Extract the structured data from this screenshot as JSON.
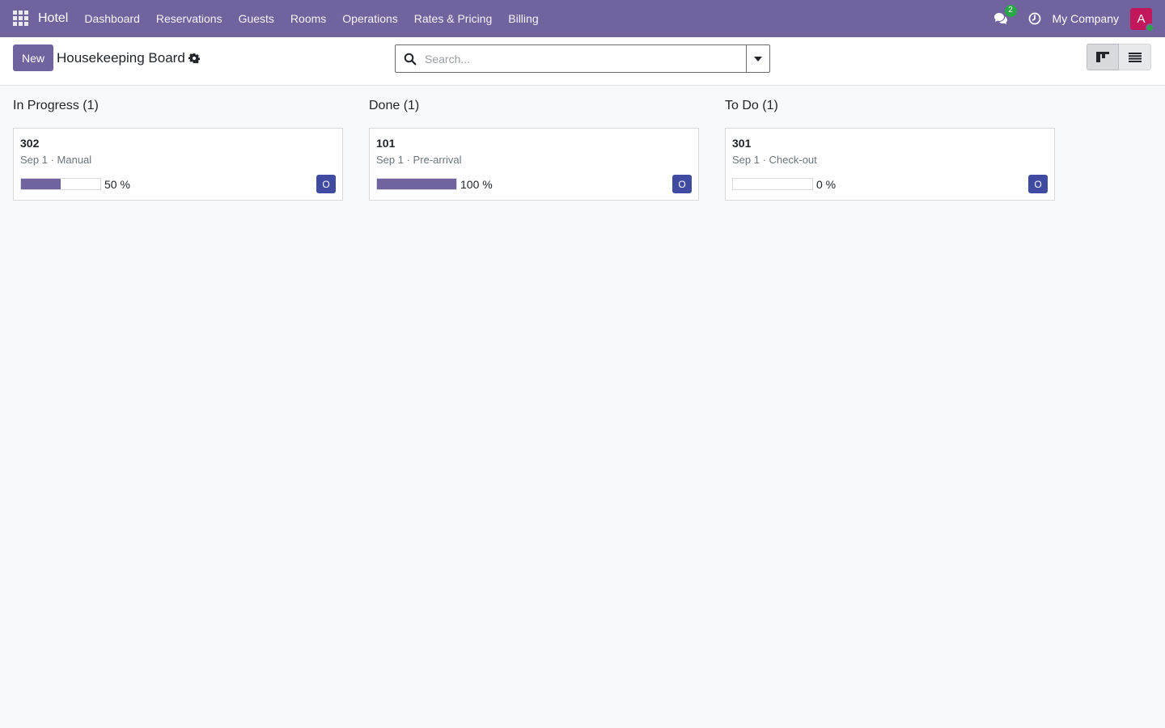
{
  "navbar": {
    "app_name": "Hotel",
    "menu": [
      "Dashboard",
      "Reservations",
      "Guests",
      "Rooms",
      "Operations",
      "Rates & Pricing",
      "Billing"
    ],
    "messages_count": "2",
    "company": "My Company",
    "user_initial": "A",
    "bar_color": "#71639e",
    "avatar_color": "#c2185b"
  },
  "control_panel": {
    "new_label": "New",
    "title": "Housekeeping Board",
    "search_placeholder": "Search..."
  },
  "kanban": {
    "columns": [
      {
        "header": "In Progress (1)",
        "cards": [
          {
            "title": "302",
            "subtitle": "Sep 1 · Manual",
            "progress": 50,
            "progress_label": "50 %",
            "assignee": "O"
          }
        ]
      },
      {
        "header": "Done (1)",
        "cards": [
          {
            "title": "101",
            "subtitle": "Sep 1 · Pre-arrival",
            "progress": 100,
            "progress_label": "100 %",
            "assignee": "O"
          }
        ]
      },
      {
        "header": "To Do (1)",
        "cards": [
          {
            "title": "301",
            "subtitle": "Sep 1 · Check-out",
            "progress": 0,
            "progress_label": "0 %",
            "assignee": "O"
          }
        ]
      }
    ]
  }
}
